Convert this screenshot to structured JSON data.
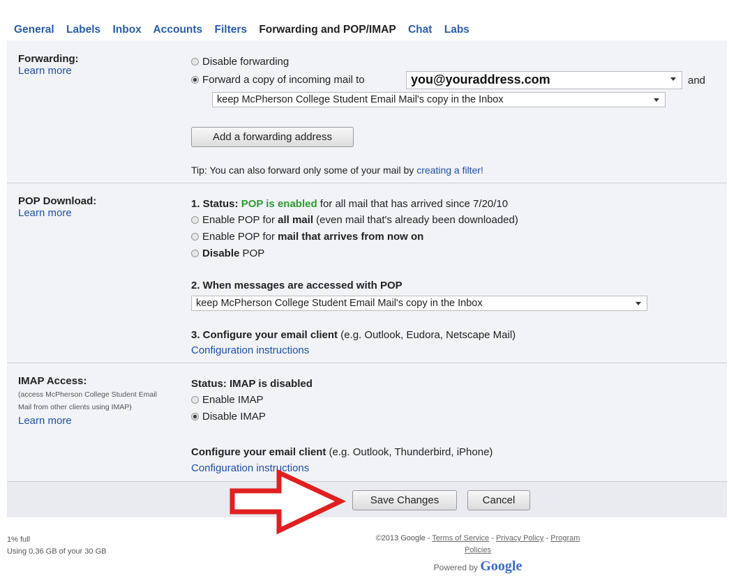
{
  "tabs": [
    "General",
    "Labels",
    "Inbox",
    "Accounts",
    "Filters",
    "Forwarding and POP/IMAP",
    "Chat",
    "Labs"
  ],
  "forwarding": {
    "heading": "Forwarding:",
    "learn_more": "Learn more",
    "disable_label": "Disable forwarding",
    "forward_label": "Forward a copy of incoming mail to",
    "address": "you@youraddress.com",
    "and": "and",
    "keep_option": "keep McPherson College Student Email Mail's copy in the Inbox",
    "add_button": "Add a forwarding address",
    "tip_prefix": "Tip: You can also forward only some of your mail by",
    "tip_link": "creating a filter!"
  },
  "pop": {
    "heading": "POP Download:",
    "learn_more": "Learn more",
    "status_label": "1. Status:",
    "status_value": "POP is enabled",
    "status_suffix": "for all mail that has arrived since 7/20/10",
    "opt1_pre": "Enable POP for",
    "opt1_bold": "all mail",
    "opt1_post": "(even mail that's already been downloaded)",
    "opt2_pre": "Enable POP for",
    "opt2_bold": "mail that arrives from now on",
    "opt3_bold": "Disable",
    "opt3_post": "POP",
    "access_heading": "2. When messages are accessed with POP",
    "access_option": "keep McPherson College Student Email Mail's copy in the Inbox",
    "configure_bold": "3. Configure your email client",
    "configure_rest": "(e.g. Outlook, Eudora, Netscape Mail)",
    "config_link": "Configuration instructions"
  },
  "imap": {
    "heading": "IMAP Access:",
    "desc": "(access McPherson College Student Email Mail from other clients using IMAP)",
    "learn_more": "Learn more",
    "status": "Status: IMAP is disabled",
    "enable": "Enable IMAP",
    "disable": "Disable IMAP",
    "configure_bold": "Configure your email client",
    "configure_rest": "(e.g. Outlook, Thunderbird, iPhone)",
    "config_link": "Configuration instructions"
  },
  "buttons": {
    "save": "Save Changes",
    "cancel": "Cancel"
  },
  "footer": {
    "usage_pct": "1% full",
    "usage": "Using 0.36 GB of your 30 GB",
    "copyright": "©2013 Google",
    "terms": "Terms of Service",
    "privacy": "Privacy Policy",
    "program": "Program Policies",
    "powered": "Powered by",
    "brand": "Google"
  },
  "colors": {
    "link": "#1f4fb0",
    "status_green": "#2d9a2d",
    "arrow": "#e02020",
    "panel": "#f1f3f7"
  }
}
